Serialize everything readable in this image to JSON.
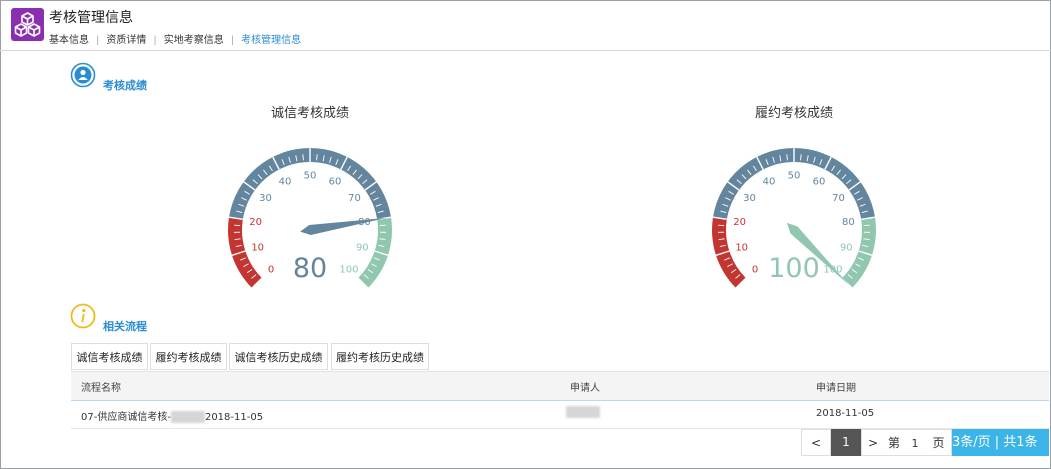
{
  "header": {
    "title": "考核管理信息",
    "tabs": [
      {
        "label": "基本信息"
      },
      {
        "label": "资质详情"
      },
      {
        "label": "实地考察信息"
      },
      {
        "label": "考核管理信息"
      }
    ],
    "separator": "|"
  },
  "sections": {
    "score_title": "考核成绩",
    "flow_title": "相关流程"
  },
  "gauges": [
    {
      "title": "诚信考核成绩",
      "value": 80,
      "display": "80",
      "min": 0,
      "max": 100
    },
    {
      "title": "履约考核成绩",
      "value": 100,
      "display": "100",
      "min": 0,
      "max": 100
    }
  ],
  "gauge_ticks": [
    "0",
    "10",
    "20",
    "30",
    "40",
    "50",
    "60",
    "70",
    "80",
    "90",
    "100"
  ],
  "gauge_colors": {
    "red": "#c23531",
    "blue": "#63869e",
    "green": "#91c7ae"
  },
  "flow_tabs": [
    {
      "label": "诚信考核成绩"
    },
    {
      "label": "履约考核成绩"
    },
    {
      "label": "诚信考核历史成绩"
    },
    {
      "label": "履约考核历史成绩"
    }
  ],
  "table": {
    "columns": [
      "流程名称",
      "申请人",
      "申请日期"
    ],
    "rows": [
      {
        "name_prefix": "07-供应商诚信考核-",
        "name_suffix": "2018-11-05",
        "date": "2018-11-05"
      }
    ]
  },
  "pager": {
    "prev": "<",
    "current": "1",
    "next": ">",
    "goto_prefix": "第",
    "goto_page": "1",
    "goto_suffix": "页",
    "summary": "3条/页 | 共1条",
    "accent": "#3bb4e8"
  }
}
